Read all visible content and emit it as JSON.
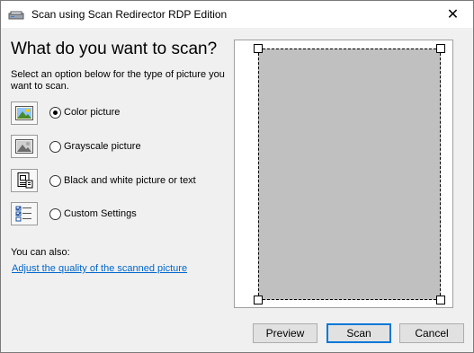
{
  "window": {
    "title": "Scan using Scan Redirector RDP Edition",
    "close_glyph": "✕"
  },
  "main": {
    "heading": "What do you want to scan?",
    "instructions": "Select an option below for the type of picture you want to scan.",
    "options": [
      {
        "label": "Color picture",
        "icon": "color-picture-icon",
        "selected": true
      },
      {
        "label": "Grayscale picture",
        "icon": "grayscale-picture-icon",
        "selected": false
      },
      {
        "label": "Black and white picture or text",
        "icon": "black-white-picture-icon",
        "selected": false
      },
      {
        "label": "Custom Settings",
        "icon": "custom-settings-icon",
        "selected": false
      }
    ],
    "also_label": "You can also:",
    "adjust_link": "Adjust the quality of the scanned picture"
  },
  "buttons": {
    "preview": "Preview",
    "scan": "Scan",
    "cancel": "Cancel"
  },
  "colors": {
    "link": "#0066cc",
    "preview_area": "#c0c0c0",
    "default_button_border": "#0078d7"
  }
}
